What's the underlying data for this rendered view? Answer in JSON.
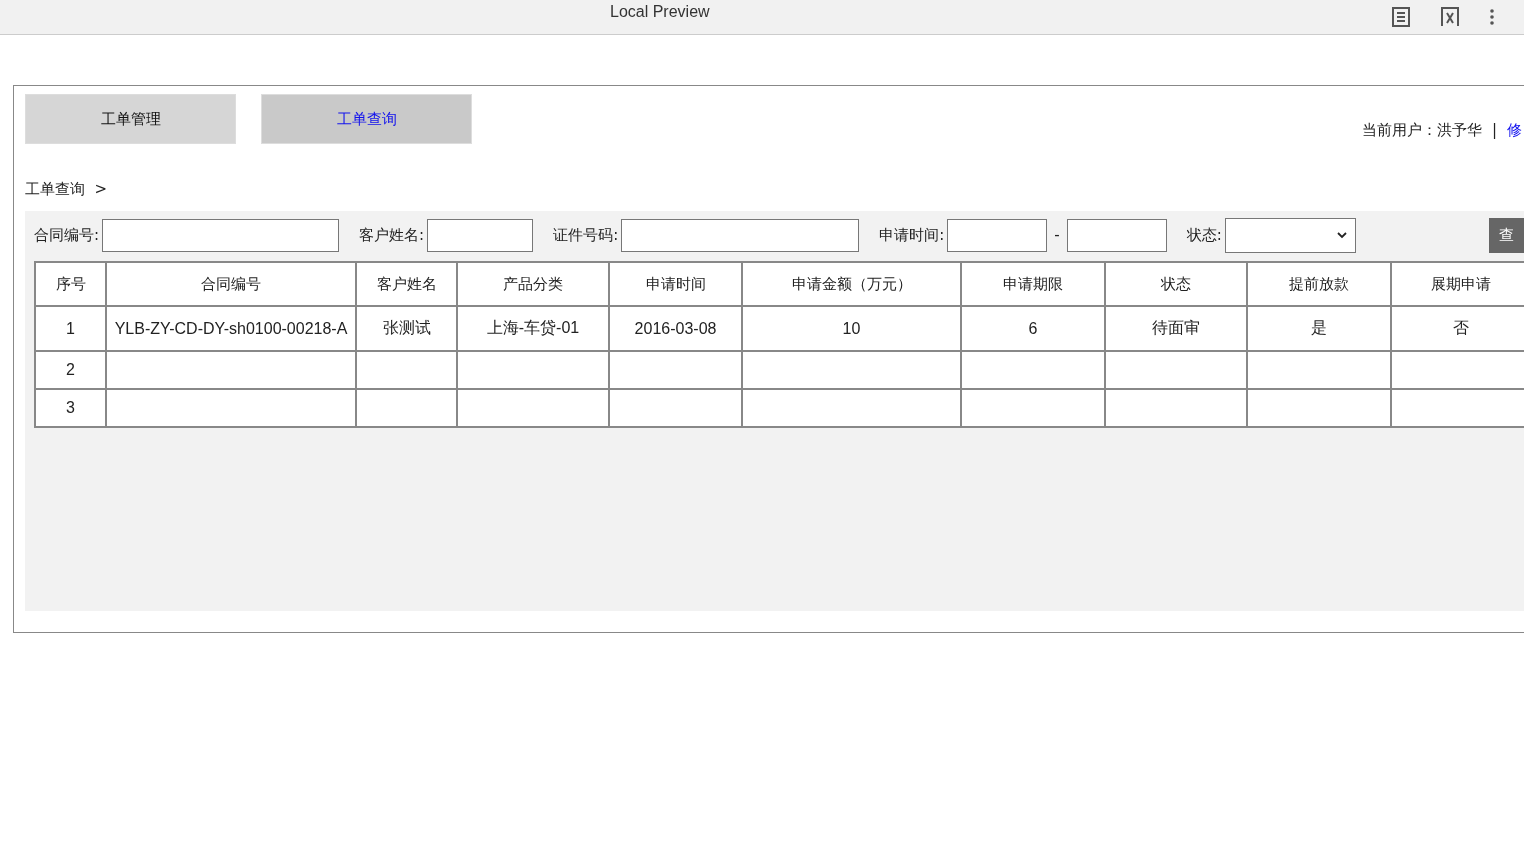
{
  "window": {
    "title": "Local Preview"
  },
  "tabs": [
    {
      "label": "工单管理",
      "selected": false
    },
    {
      "label": "工单查询",
      "selected": true
    }
  ],
  "user": {
    "label": "当前用户：",
    "name": "洪予华",
    "separator": "|",
    "link": "修"
  },
  "breadcrumb": {
    "label": "工单查询",
    "arrow": ">"
  },
  "filters": {
    "contract_no": {
      "label": "合同编号:"
    },
    "customer_name": {
      "label": "客户姓名:"
    },
    "id_no": {
      "label": "证件号码:"
    },
    "apply_time": {
      "label": "申请时间:",
      "separator": "-"
    },
    "status": {
      "label": "状态:"
    },
    "search_button": "查"
  },
  "table": {
    "columns": [
      "序号",
      "合同编号",
      "客户姓名",
      "产品分类",
      "申请时间",
      "申请金额（万元）",
      "申请期限",
      "状态",
      "提前放款",
      "展期申请"
    ],
    "rows": [
      {
        "cells": [
          "1",
          "YLB-ZY-CD-DY-sh0100-00218-A",
          "张测试",
          "上海-车贷-01",
          "2016-03-08",
          "10",
          "6",
          "待面审",
          "是",
          "否"
        ]
      },
      {
        "cells": [
          "2"
        ]
      },
      {
        "cells": [
          "3"
        ]
      }
    ]
  }
}
